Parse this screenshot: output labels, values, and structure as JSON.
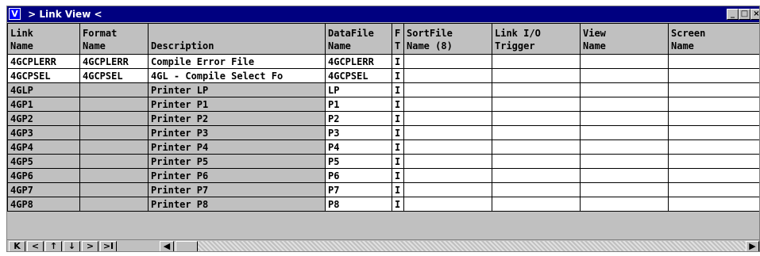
{
  "window": {
    "title": " > Link View <",
    "app_icon": "V"
  },
  "columns": [
    {
      "key": "link_name",
      "label": "Link\nName"
    },
    {
      "key": "format_name",
      "label": "Format\nName"
    },
    {
      "key": "description",
      "label": "Description"
    },
    {
      "key": "datafile_name",
      "label": "DataFile\nName"
    },
    {
      "key": "ft",
      "label": "F\nT"
    },
    {
      "key": "sortfile",
      "label": "SortFile\nName (8)"
    },
    {
      "key": "link_io",
      "label": "Link I/O\nTrigger"
    },
    {
      "key": "view_name",
      "label": "View\nName"
    },
    {
      "key": "screen_name",
      "label": "Screen\nName"
    }
  ],
  "rows": [
    [
      "4GCPLERR",
      "4GCPLERR",
      "Compile Error File",
      "4GCPLERR",
      "I",
      "",
      "",
      "",
      ""
    ],
    [
      "4GCPSEL",
      "4GCPSEL",
      "4GL - Compile Select Fo",
      "4GCPSEL",
      "I",
      "",
      "",
      "",
      ""
    ],
    [
      "4GLP",
      "",
      "Printer LP",
      "LP",
      "I",
      "",
      "",
      "",
      ""
    ],
    [
      "4GP1",
      "",
      "Printer P1",
      "P1",
      "I",
      "",
      "",
      "",
      ""
    ],
    [
      "4GP2",
      "",
      "Printer P2",
      "P2",
      "I",
      "",
      "",
      "",
      ""
    ],
    [
      "4GP3",
      "",
      "Printer P3",
      "P3",
      "I",
      "",
      "",
      "",
      ""
    ],
    [
      "4GP4",
      "",
      "Printer P4",
      "P4",
      "I",
      "",
      "",
      "",
      ""
    ],
    [
      "4GP5",
      "",
      "Printer P5",
      "P5",
      "I",
      "",
      "",
      "",
      ""
    ],
    [
      "4GP6",
      "",
      "Printer P6",
      "P6",
      "I",
      "",
      "",
      "",
      ""
    ],
    [
      "4GP7",
      "",
      "Printer P7",
      "P7",
      "I",
      "",
      "",
      "",
      ""
    ],
    [
      "4GP8",
      "",
      "Printer P8",
      "P8",
      "I",
      "",
      "",
      "",
      ""
    ]
  ],
  "nav": {
    "first": "K",
    "prev": "<",
    "up": "↑",
    "down": "↓",
    "next": ">",
    "last": ">I",
    "scroll_left": "◀",
    "scroll_right": "▶"
  }
}
